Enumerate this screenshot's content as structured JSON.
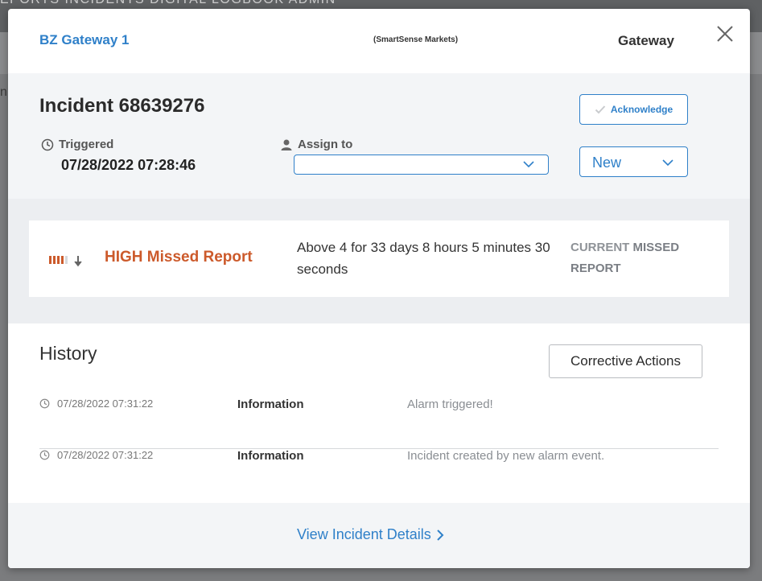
{
  "background": {
    "nav_text": "EPORTS   INCIDENTS   DIGITAL LOGBOOK   ADMIN",
    "partial_letter": "n"
  },
  "header": {
    "gateway_name": "BZ Gateway 1",
    "customer": "(SmartSense Markets)",
    "device_type": "Gateway",
    "close_icon": "close-icon"
  },
  "incident": {
    "title": "Incident 68639276",
    "triggered_label": "Triggered",
    "triggered_value": "07/28/2022 07:28:46",
    "assign_label": "Assign to",
    "assign_value": "",
    "acknowledge_label": "Acknowledge",
    "status_value": "New"
  },
  "alarm": {
    "name": "HIGH Missed Report",
    "description": "Above 4 for 33 days 8 hours 5 minutes 30 seconds",
    "state_prefix": "CURRENT",
    "state_strong": "MISSED REPORT"
  },
  "history": {
    "title": "History",
    "corrective_label": "Corrective Actions",
    "rows": [
      {
        "time": "07/28/2022 07:31:22",
        "type": "Information",
        "message": "Alarm triggered!"
      },
      {
        "time": "07/28/2022 07:31:22",
        "type": "Information",
        "message": "Incident created by new alarm event."
      }
    ]
  },
  "footer": {
    "view_details_label": "View Incident Details"
  },
  "colors": {
    "accent": "#2f80c9",
    "alarm_high": "#cc5a2b",
    "overlay": "#5f6163"
  }
}
